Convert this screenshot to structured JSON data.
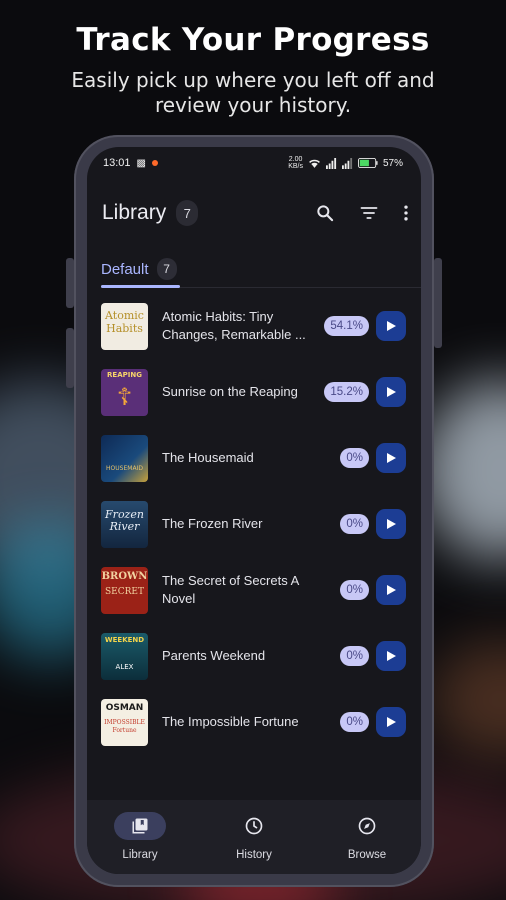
{
  "promo": {
    "headline": "Track Your Progress",
    "subline": "Easily pick up where you left off and review your history."
  },
  "status_bar": {
    "time": "13:01",
    "network_speed": "2.00\nKB/s",
    "battery": "57%"
  },
  "app_bar": {
    "title": "Library",
    "count": "7",
    "icons": [
      "search-icon",
      "filter-icon",
      "more-vert-icon"
    ]
  },
  "tabs": [
    {
      "label": "Default",
      "count": "7",
      "active": true
    }
  ],
  "books": [
    {
      "title": "Atomic Habits: Tiny Changes, Remarkable ...",
      "progress": "54.1%",
      "cover_text": "Atomic Habits"
    },
    {
      "title": "Sunrise on the Reaping",
      "progress": "15.2%",
      "cover_text": "REAPING"
    },
    {
      "title": "The Housemaid",
      "progress": "0%",
      "cover_text": "THE HOUSEMAID"
    },
    {
      "title": "The Frozen River",
      "progress": "0%",
      "cover_text": "Frozen River"
    },
    {
      "title": "The Secret of Secrets A Novel",
      "progress": "0%",
      "cover_text": "BROWN SECRET"
    },
    {
      "title": "Parents Weekend",
      "progress": "0%",
      "cover_text": "WEEKEND"
    },
    {
      "title": "The Impossible Fortune",
      "progress": "0%",
      "cover_text": "OSMAN"
    }
  ],
  "bottom_nav": [
    {
      "label": "Library",
      "icon": "library-icon",
      "active": true
    },
    {
      "label": "History",
      "icon": "history-icon",
      "active": false
    },
    {
      "label": "Browse",
      "icon": "compass-icon",
      "active": false
    }
  ],
  "colors": {
    "accent": "#aab6ff",
    "play_button": "#1c3d94",
    "progress_badge": "#c8c8f6",
    "screen_bg": "#17171c"
  }
}
